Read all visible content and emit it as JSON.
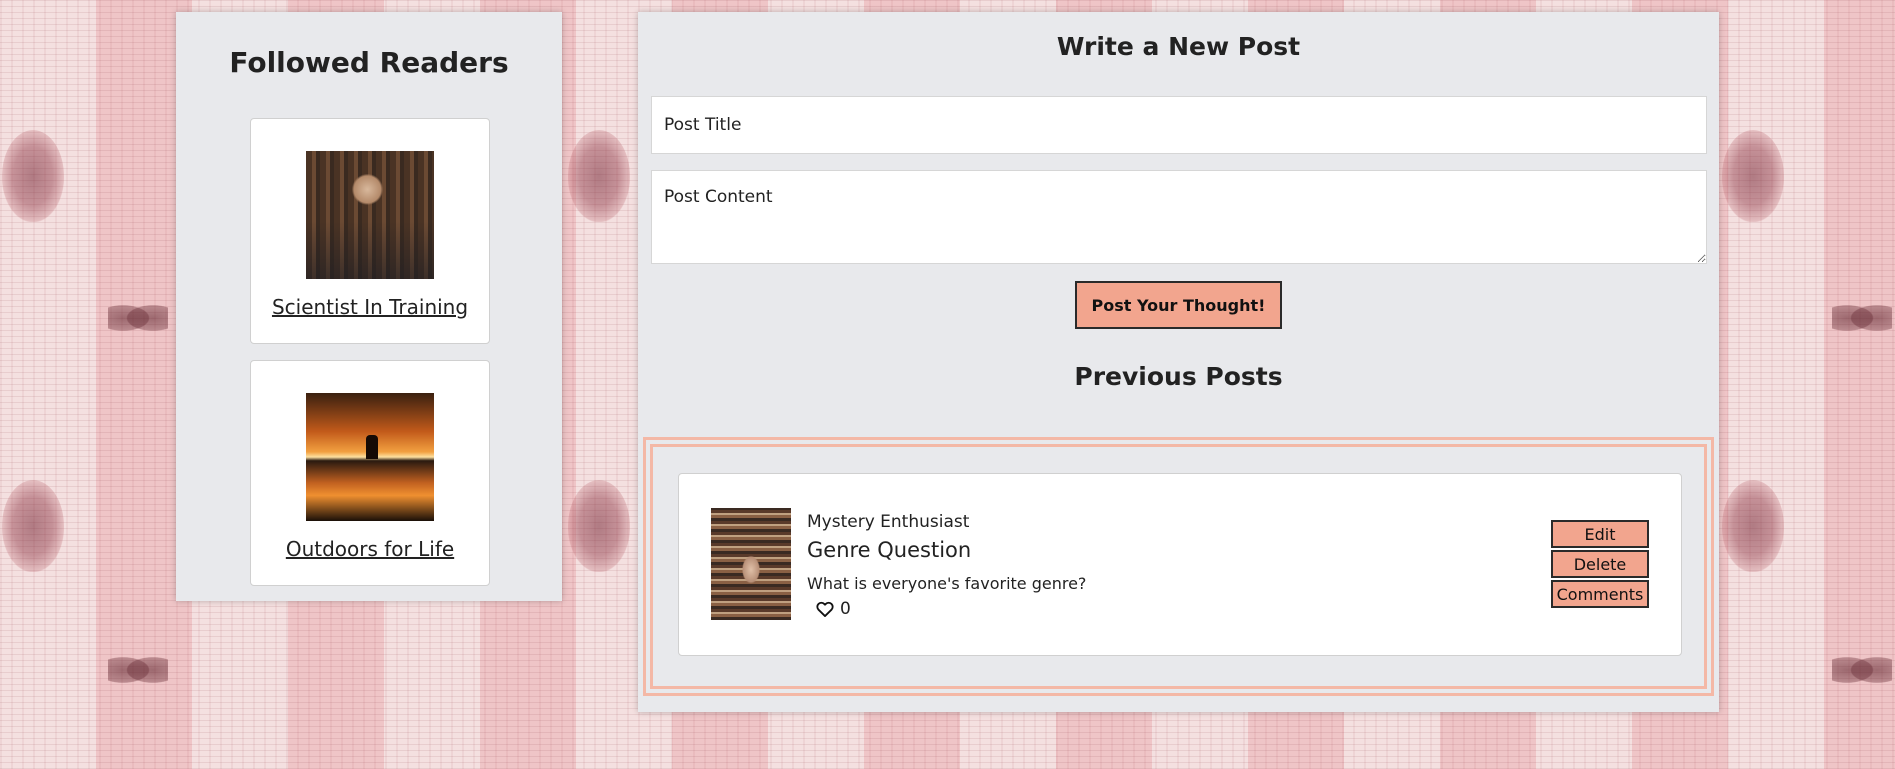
{
  "followed": {
    "title": "Followed Readers",
    "readers": [
      {
        "name": "Scientist In Training",
        "photo_icon": "reader-photo-scientist"
      },
      {
        "name": "Outdoors for Life",
        "photo_icon": "reader-photo-outdoors"
      }
    ]
  },
  "composer": {
    "heading": "Write a New Post",
    "title_placeholder": "Post Title",
    "content_placeholder": "Post Content",
    "submit_label": "Post Your Thought!"
  },
  "previous": {
    "heading": "Previous Posts",
    "posts": [
      {
        "author": "Mystery Enthusiast",
        "title": "Genre Question",
        "content": "What is everyone's favorite genre?",
        "likes": "0",
        "actions": {
          "edit": "Edit",
          "delete": "Delete",
          "comments": "Comments"
        }
      }
    ]
  },
  "colors": {
    "accent_button": "#f2a58e",
    "panel_bg": "#e8e9ec",
    "frame_border": "#f4b8a6"
  }
}
